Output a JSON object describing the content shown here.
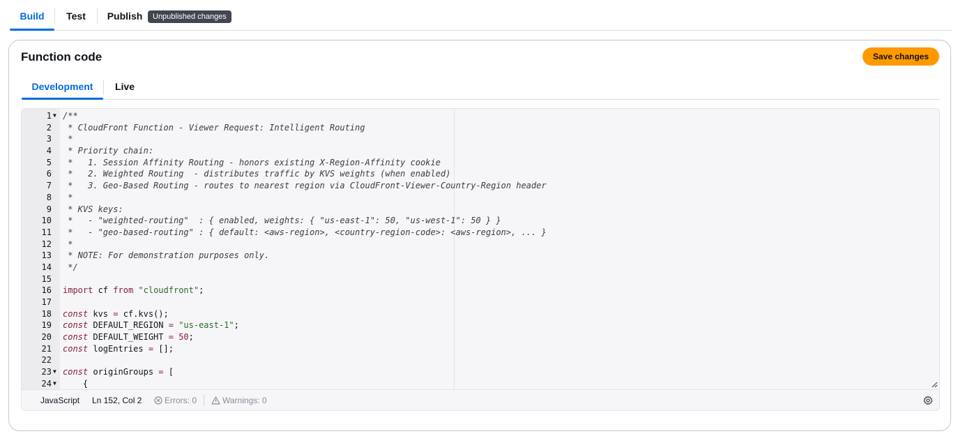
{
  "top_tabs": {
    "build": "Build",
    "test": "Test",
    "publish": "Publish",
    "badge": "Unpublished changes"
  },
  "card": {
    "title": "Function code",
    "save_label": "Save changes",
    "tabs": [
      "Development",
      "Live"
    ]
  },
  "editor": {
    "code_lines": [
      "/**",
      " * CloudFront Function - Viewer Request: Intelligent Routing",
      " *",
      " * Priority chain:",
      " *   1. Session Affinity Routing - honors existing X-Region-Affinity cookie",
      " *   2. Weighted Routing  - distributes traffic by KVS weights (when enabled)",
      " *   3. Geo-Based Routing - routes to nearest region via CloudFront-Viewer-Country-Region header",
      " *",
      " * KVS keys:",
      " *   - \"weighted-routing\"  : { enabled, weights: { \"us-east-1\": 50, \"us-west-1\": 50 } }",
      " *   - \"geo-based-routing\" : { default: <aws-region>, <country-region-code>: <aws-region>, ... }",
      " *",
      " * NOTE: For demonstration purposes only.",
      " */",
      "",
      "import cf from \"cloudfront\";",
      "",
      "const kvs = cf.kvs();",
      "const DEFAULT_REGION = \"us-east-1\";",
      "const DEFAULT_WEIGHT = 50;",
      "const logEntries = [];",
      "",
      "const originGroups = [",
      "    {"
    ],
    "fold_lines": [
      1,
      23,
      24
    ],
    "fold_icon": "fold-arrow-icon"
  },
  "status": {
    "language": "JavaScript",
    "cursor": "Ln 152, Col 2",
    "errors": "Errors: 0",
    "warnings": "Warnings: 0",
    "settings_icon": "gear-icon"
  },
  "colors": {
    "accent": "#006ce0",
    "save_button": "#ff9900",
    "badge": "#424650"
  }
}
